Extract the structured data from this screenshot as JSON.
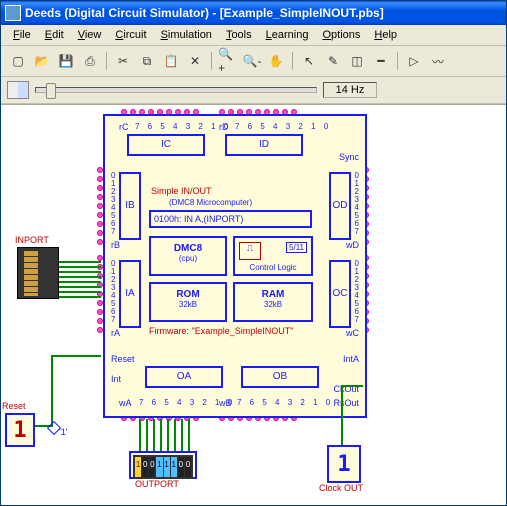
{
  "app": {
    "title": "Deeds (Digital Circuit Simulator) - [Example_SimpleINOUT.pbs]"
  },
  "menu": {
    "file": "File",
    "edit": "Edit",
    "view": "View",
    "circuit": "Circuit",
    "simulation": "Simulation",
    "tools": "Tools",
    "learning": "Learning",
    "options": "Options",
    "help": "Help"
  },
  "status": {
    "freq": "14 Hz"
  },
  "chip": {
    "title1": "Simple IN/OUT",
    "title2": "(DMC8 Microcomputer)",
    "instr": "0100h:  IN   A,(INPORT)",
    "cpu": "DMC8",
    "cpusub": "(cpu)",
    "ctrl": "Control Logic",
    "ctrlnum": "5/11",
    "rom": "ROM",
    "romsz": "32kB",
    "ram": "RAM",
    "ramsz": "32kB",
    "firmware": "Firmware: \"Example_SimpleINOUT\"",
    "ia": "IA",
    "ib": "IB",
    "ic": "IC",
    "id": "ID",
    "oa": "OA",
    "ob": "OB",
    "oc": "OC",
    "od": "OD",
    "ra": "rA",
    "rb": "rB",
    "rc": "rC",
    "rd": "rD",
    "wa": "wA",
    "wb": "wB",
    "wc": "wC",
    "wd": "wD",
    "sync": "Sync",
    "inta": "IntA",
    "ckout": "CkOut",
    "rsout": "RsOut",
    "reset": "Reset",
    "int": "Int",
    "bits": "7 6 5 4 3 2 1 0",
    "vbits": "0\n1\n2\n3\n4\n5\n6\n7"
  },
  "ext": {
    "inport": "INPORT",
    "outport": "OUTPORT",
    "clockout": "Clock OUT",
    "reset": "Reset",
    "one": "'1'",
    "seg": "1"
  },
  "outbits": [
    "1",
    "0",
    "0",
    "1",
    "1",
    "1",
    "0",
    "0"
  ]
}
